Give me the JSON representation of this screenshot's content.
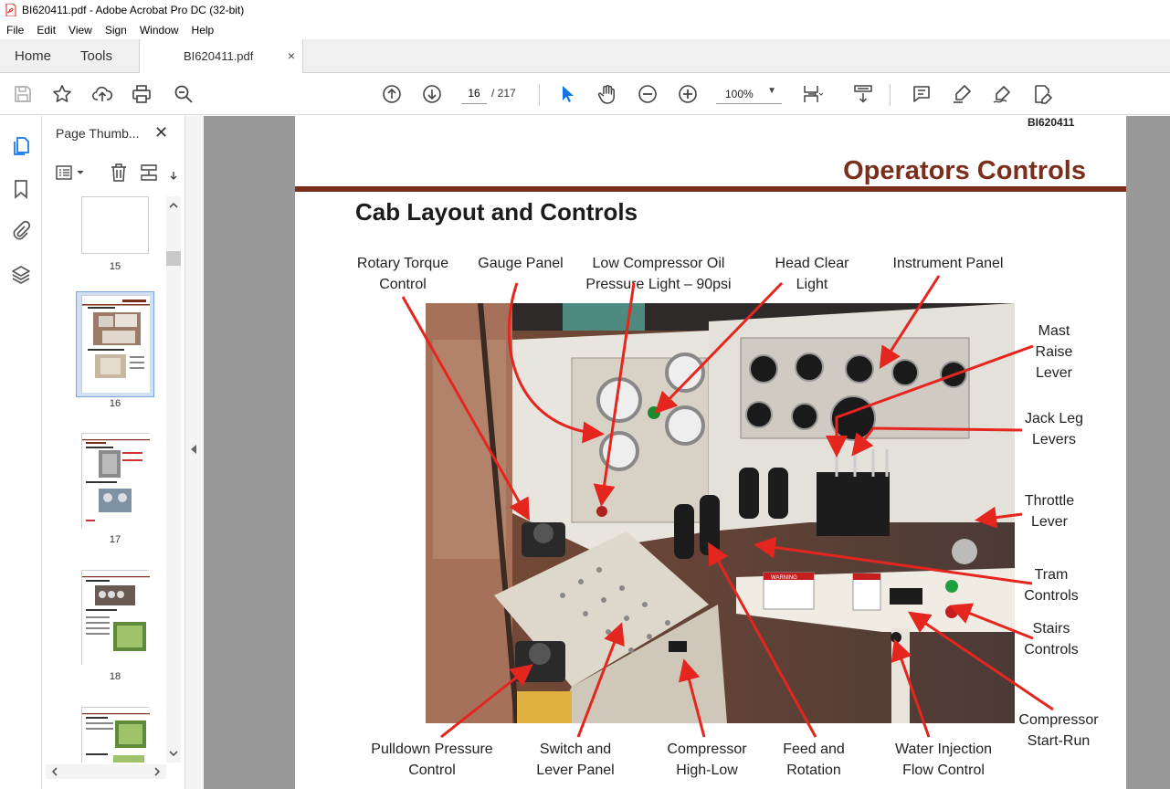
{
  "window": {
    "title": "BI620411.pdf - Adobe Acrobat Pro DC (32-bit)"
  },
  "menu": [
    "File",
    "Edit",
    "View",
    "Sign",
    "Window",
    "Help"
  ],
  "tabs": {
    "home": "Home",
    "tools": "Tools",
    "document": "BI620411.pdf",
    "close_glyph": "×"
  },
  "toolbar": {
    "current_page": "16",
    "total_pages": "/ 217",
    "zoom": "100%",
    "icons": [
      "save-icon",
      "star-icon",
      "upload-icon",
      "print-icon",
      "zoom-search-icon",
      "page-up-icon",
      "page-down-icon",
      "select-arrow-icon",
      "hand-icon",
      "zoom-out-icon",
      "zoom-in-icon",
      "fit-page-icon",
      "scroll-mode-icon",
      "comment-icon",
      "highlight-icon",
      "sign-icon",
      "edit-pdf-icon"
    ],
    "accent": "#1473e6"
  },
  "sidebar": {
    "title": "Page Thumb...",
    "close_glyph": "✕",
    "thumbnails": [
      {
        "page": "15"
      },
      {
        "page": "16",
        "selected": true
      },
      {
        "page": "17"
      },
      {
        "page": "18"
      }
    ]
  },
  "document": {
    "doc_id": "BI620411",
    "heading": "Operators Controls",
    "subheading": "Cab Layout and Controls",
    "heading_color": "#7a2f1c",
    "callouts": {
      "rotary_torque": [
        "Rotary Torque",
        "Control"
      ],
      "gauge_panel": [
        "Gauge Panel"
      ],
      "low_compressor": [
        "Low Compressor Oil",
        "Pressure Light – 90psi"
      ],
      "head_clear": [
        "Head Clear",
        "Light"
      ],
      "instrument_panel": [
        "Instrument Panel"
      ],
      "mast_raise": [
        "Mast",
        "Raise",
        "Lever"
      ],
      "jack_leg": [
        "Jack Leg",
        "Levers"
      ],
      "throttle": [
        "Throttle",
        "Lever"
      ],
      "tram": [
        "Tram",
        "Controls"
      ],
      "stairs": [
        "Stairs",
        "Controls"
      ],
      "compressor_start": [
        "Compressor",
        "Start-Run"
      ],
      "pulldown": [
        "Pulldown Pressure",
        "Control"
      ],
      "switch_lever": [
        "Switch and",
        "Lever Panel"
      ],
      "compressor_highlow": [
        "Compressor",
        "High-Low"
      ],
      "feed_rotation": [
        "Feed and",
        "Rotation"
      ],
      "water_injection": [
        "Water Injection",
        "Flow Control"
      ]
    },
    "photo_warning": "WARNING",
    "arrow_color": "#e4261f"
  }
}
